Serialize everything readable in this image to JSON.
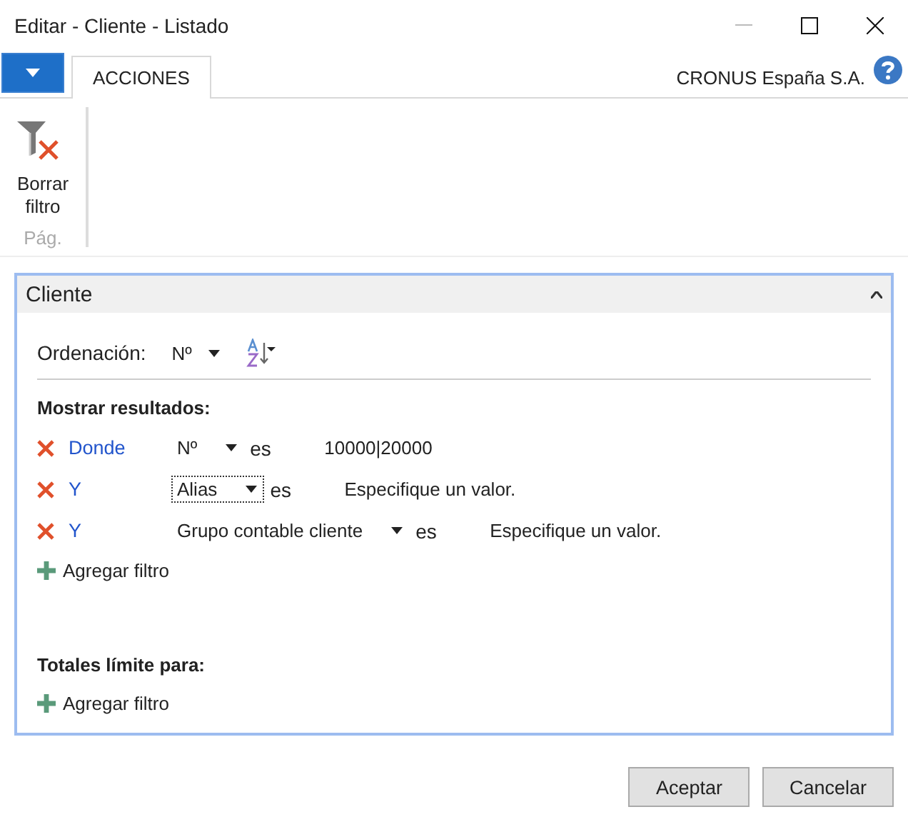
{
  "window": {
    "title": "Editar - Cliente - Listado"
  },
  "tabs": [
    {
      "label": "ACCIONES",
      "selected": true
    }
  ],
  "company": "CRONUS España S.A.",
  "ribbon": {
    "actions": [
      {
        "label": "Borrar filtro"
      }
    ],
    "group": "Pág."
  },
  "panel": {
    "title": "Cliente",
    "expanded": true,
    "sort": {
      "label": "Ordenación:",
      "field": "Nº"
    },
    "filters_heading": "Mostrar resultados:",
    "filters": [
      {
        "conjunction": "Donde",
        "field": "Nº",
        "focused": false,
        "operator": "es",
        "value": "10000|20000"
      },
      {
        "conjunction": "Y",
        "field": "Alias",
        "focused": true,
        "operator": "es",
        "placeholder": "Especifique un valor."
      },
      {
        "conjunction": "Y",
        "field": "Grupo contable cliente",
        "focused": false,
        "operator": "es",
        "placeholder": "Especifique un valor."
      }
    ],
    "add_filter": "Agregar filtro",
    "totals_heading": "Totales límite para:",
    "totals_add_filter": "Agregar filtro"
  },
  "buttons": [
    "Aceptar",
    "Cancelar"
  ]
}
